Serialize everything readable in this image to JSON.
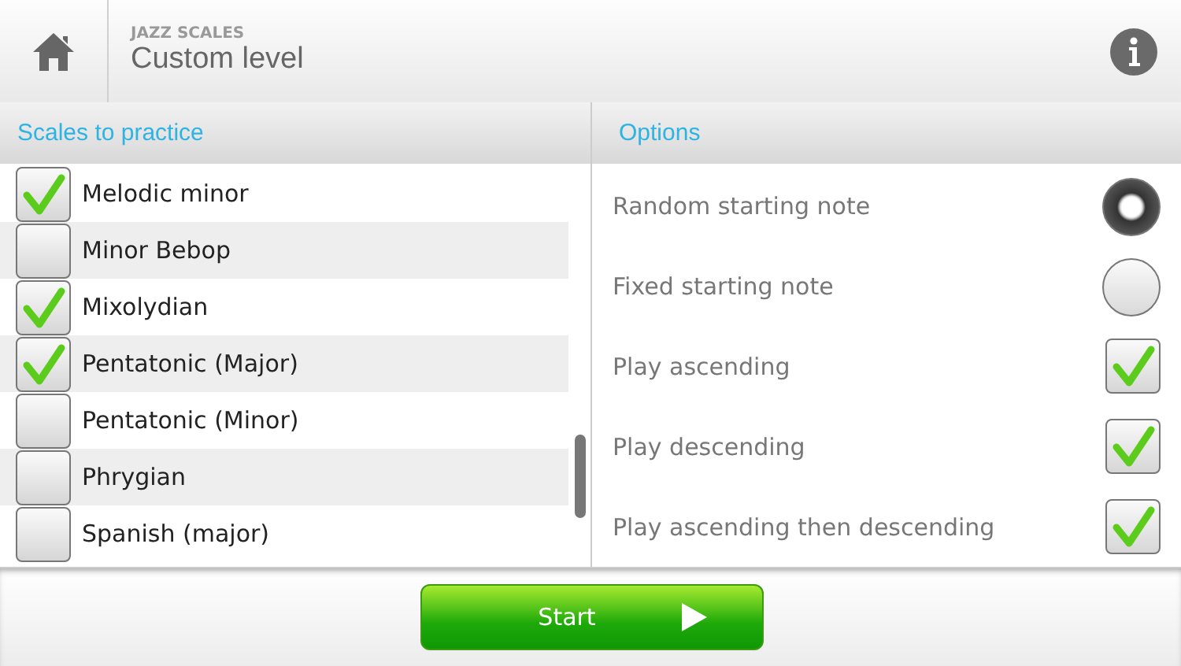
{
  "header": {
    "app_name": "JAZZ SCALES",
    "title": "Custom level"
  },
  "scales": {
    "heading": "Scales to practice",
    "items": [
      {
        "label": "Melodic minor",
        "checked": true
      },
      {
        "label": "Minor Bebop",
        "checked": false
      },
      {
        "label": "Mixolydian",
        "checked": true
      },
      {
        "label": "Pentatonic (Major)",
        "checked": true
      },
      {
        "label": "Pentatonic (Minor)",
        "checked": false
      },
      {
        "label": "Phrygian",
        "checked": false
      },
      {
        "label": "Spanish (major)",
        "checked": false
      }
    ]
  },
  "options": {
    "heading": "Options",
    "items": [
      {
        "label": "Random starting note",
        "kind": "radio",
        "selected": true
      },
      {
        "label": "Fixed starting note",
        "kind": "radio",
        "selected": false
      },
      {
        "label": "Play ascending",
        "kind": "checkbox",
        "checked": true
      },
      {
        "label": "Play descending",
        "kind": "checkbox",
        "checked": true
      },
      {
        "label": "Play ascending then descending",
        "kind": "checkbox",
        "checked": true
      }
    ]
  },
  "start_button": {
    "label": "Start"
  }
}
